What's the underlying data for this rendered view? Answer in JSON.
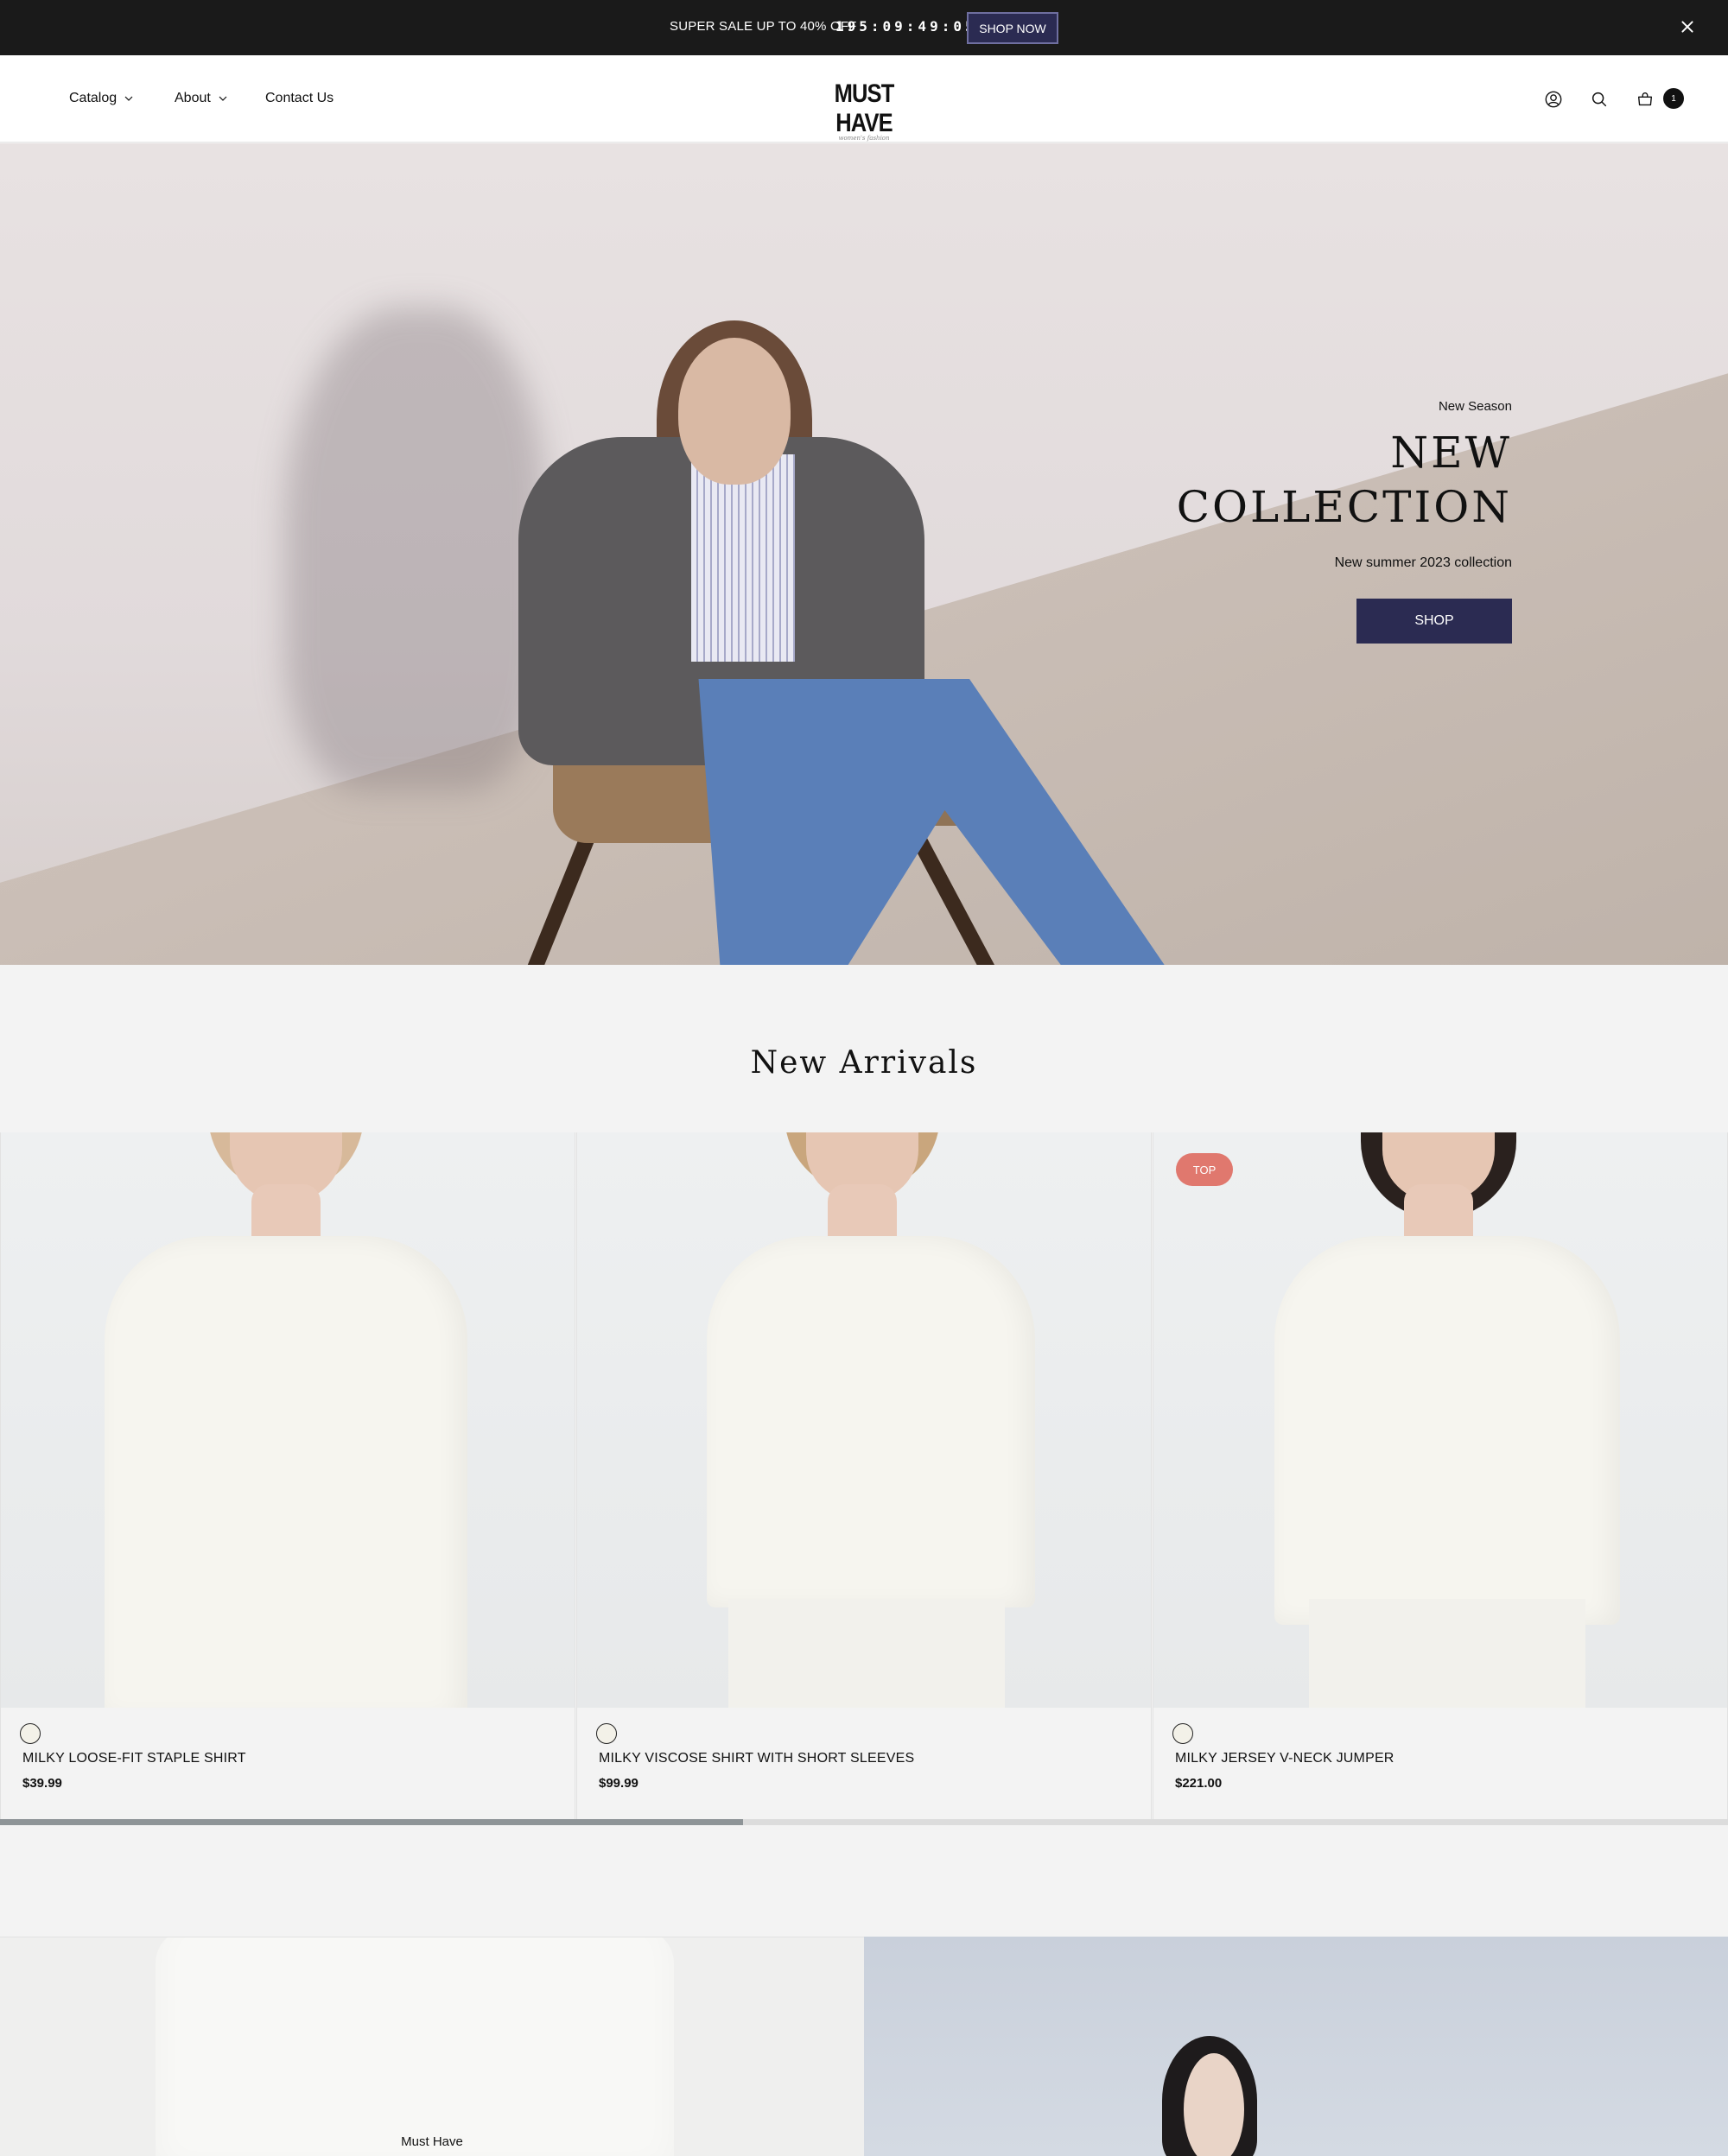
{
  "announcement": {
    "message": "SUPER SALE UP TO 40% OFF",
    "timer": "195:09:49:05",
    "cta_label": "SHOP NOW",
    "close_icon": "close-icon"
  },
  "header": {
    "nav": [
      {
        "label": "Catalog",
        "has_dropdown": true
      },
      {
        "label": "About",
        "has_dropdown": true
      },
      {
        "label": "Contact Us",
        "has_dropdown": false
      }
    ],
    "logo": {
      "text": "MUST HAVE",
      "tagline": "women's fashion"
    },
    "icons": [
      "account-icon",
      "search-icon",
      "cart-icon"
    ],
    "cart_count": "1"
  },
  "hero": {
    "eyebrow": "New Season",
    "title_line1": "NEW",
    "title_line2": "COLLECTION",
    "subtitle": "New summer 2023 collection",
    "cta_label": "SHOP"
  },
  "new_arrivals": {
    "title": "New Arrivals",
    "products": [
      {
        "name": "MILKY LOOSE-FIT STAPLE SHIRT",
        "price": "$39.99",
        "badge": "",
        "swatch_color": "#f3f1e8"
      },
      {
        "name": "MILKY VISCOSE SHIRT WITH SHORT SLEEVES",
        "price": "$99.99",
        "badge": "",
        "swatch_color": "#f3f1e8"
      },
      {
        "name": "MILKY JERSEY V-NECK JUMPER",
        "price": "$221.00",
        "badge": "TOP",
        "swatch_color": "#f3f1e8"
      }
    ],
    "scroll_progress": 0.43
  },
  "banners": {
    "left_label": "Must Have"
  },
  "colors": {
    "accent": "#2b2b52",
    "badge": "#e0786e",
    "announce_bg": "#1a1a1a"
  }
}
